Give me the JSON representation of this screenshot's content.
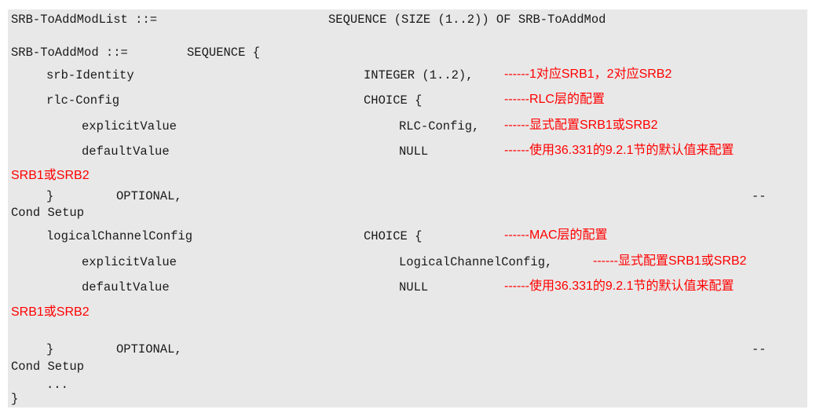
{
  "code": {
    "l1_left": "SRB-ToAddModList ::=",
    "l1_right": "SEQUENCE (SIZE (1..2)) OF SRB-ToAddMod",
    "l2_left": "SRB-ToAddMod ::=",
    "l2_right": "SEQUENCE {",
    "l3_left": "srb-Identity",
    "l3_right": "INTEGER (1..2),",
    "l4_left": "rlc-Config",
    "l4_right": "CHOICE {",
    "l5_left": "explicitValue",
    "l5_right": "RLC-Config,",
    "l6_left": "defaultValue",
    "l6_right": "NULL",
    "l7_brace": "}",
    "l7_opt": "OPTIONAL,",
    "l7_dash": "--",
    "l8_cond": "Cond Setup",
    "l9_left": "logicalChannelConfig",
    "l9_right": "CHOICE {",
    "l10_left": "explicitValue",
    "l10_right": "LogicalChannelConfig,",
    "l11_left": "defaultValue",
    "l11_right": "NULL",
    "l12_brace": "}",
    "l12_opt": "OPTIONAL,",
    "l12_dash": "--",
    "l13_cond": "Cond Setup",
    "l14_dots": "...",
    "l15_brace": "}"
  },
  "annotations": {
    "srb_identity": "------1对应SRB1，2对应SRB2",
    "rlc_config": "------RLC层的配置",
    "rlc_explicit": "------显式配置SRB1或SRB2",
    "rlc_default": "------使用36.331的9.2.1节的默认值来配置",
    "rlc_default_wrap": "SRB1或SRB2",
    "mac_config": "------MAC层的配置",
    "mac_explicit": "------显式配置SRB1或SRB2",
    "mac_default": "------使用36.331的9.2.1节的默认值来配置",
    "mac_default_wrap": "SRB1或SRB2"
  },
  "colors": {
    "background": "#e8e8e8",
    "code_text": "#1a1a1a",
    "annotation": "#ff0000"
  }
}
